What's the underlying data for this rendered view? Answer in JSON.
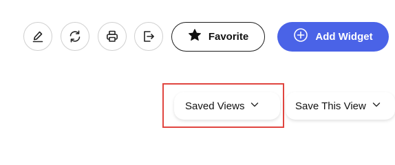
{
  "toolbar": {
    "edit_icon": "pencil-edit-icon",
    "refresh_icon": "refresh-icon",
    "print_icon": "printer-icon",
    "export_icon": "export-icon",
    "favorite_label": "Favorite",
    "favorite_icon": "star-icon",
    "add_widget_label": "Add Widget",
    "add_widget_icon": "plus-circle-icon"
  },
  "views": {
    "saved_views_label": "Saved Views",
    "save_this_view_label": "Save This View",
    "dropdown_icon": "chevron-down-icon"
  },
  "colors": {
    "accent": "#4a63e7",
    "highlight": "#e0443e"
  }
}
